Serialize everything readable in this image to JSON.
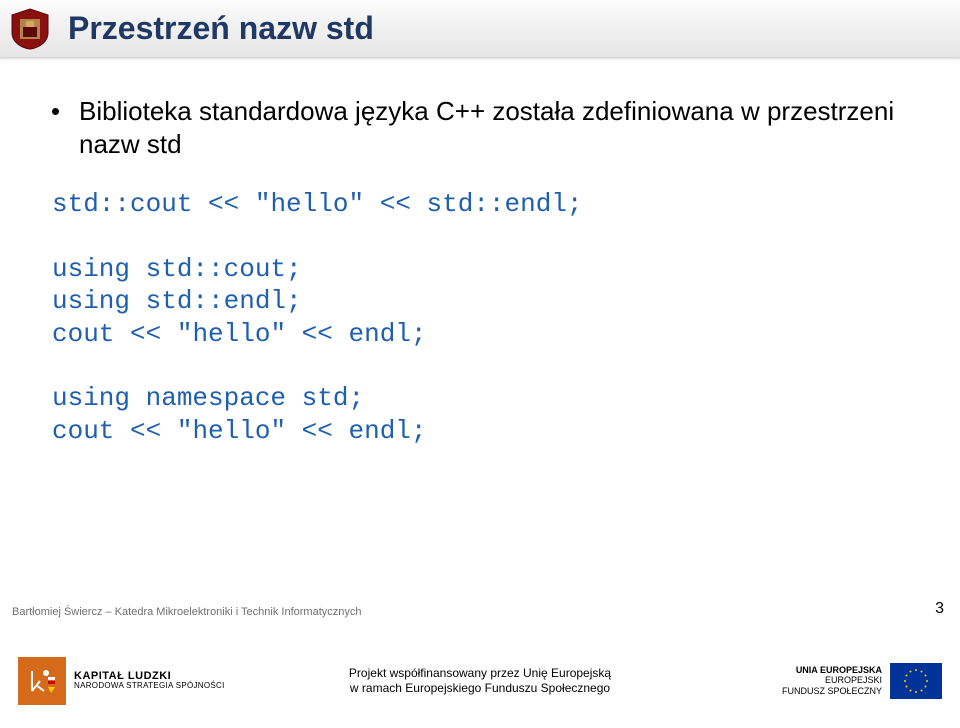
{
  "header": {
    "title": "Przestrzeń nazw std"
  },
  "bullet": {
    "text": "Biblioteka standardowa języka C++ została zdefiniowana w przestrzeni nazw std"
  },
  "code": {
    "line1_a": "std::cout ",
    "line1_b": "<<",
    "line1_c": " \"hello\" ",
    "line1_d": "<<",
    "line1_e": " std::endl;",
    "line2": "using std::cout;",
    "line3": "using std::endl;",
    "line4_a": "cout ",
    "line4_b": "<<",
    "line4_c": " \"hello\" ",
    "line4_d": "<<",
    "line4_e": " endl;",
    "line5": "using namespace std;",
    "line6_a": "cout ",
    "line6_b": "<<",
    "line6_c": " \"hello\" ",
    "line6_d": "<<",
    "line6_e": " endl;"
  },
  "footer": {
    "author": "Bartłomiej Świercz – Katedra Mikroelektroniki i Technik Informatycznych",
    "page": "3",
    "kl_line1": "KAPITAŁ LUDZKI",
    "kl_line2": "NARODOWA STRATEGIA SPÓJNOŚCI",
    "center_line1": "Projekt współfinansowany przez Unię Europejską",
    "center_line2": "w ramach Europejskiego Funduszu Społecznego",
    "eu_line1": "UNIA EUROPEJSKA",
    "eu_line2": "EUROPEJSKI",
    "eu_line3": "FUNDUSZ SPOŁECZNY"
  }
}
